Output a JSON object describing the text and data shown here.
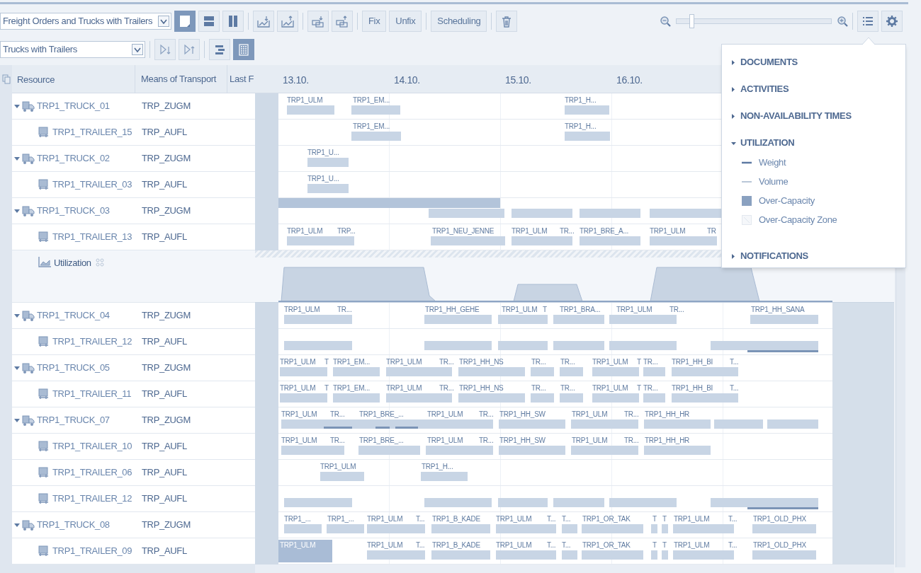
{
  "toolbar": {
    "view_select": {
      "value": "Freight Orders and Trucks with Trailers"
    },
    "layout_buttons": [
      {
        "selected": true
      },
      {
        "selected": false
      },
      {
        "selected": false
      }
    ],
    "text_buttons": [
      "Fix",
      "Unfix",
      "Scheduling"
    ],
    "zoom": {
      "level": 0.1
    },
    "hierarchy_select": {
      "value": "Trucks with Trailers"
    },
    "display_toggles": [
      {
        "selected": false
      },
      {
        "selected": true
      }
    ]
  },
  "table": {
    "columns": [
      "Resource",
      "Means of Transport",
      "Last F"
    ],
    "rows": [
      {
        "kind": "truck",
        "resource": "TRP1_TRUCK_01",
        "means": "TRP_ZUGM",
        "expanded": true,
        "orders": [
          {
            "label": "TRP1_ULM",
            "selected": false
          },
          {
            "label": "TRP1_EM...",
            "selected": false
          },
          {
            "label": "TRP1_H...",
            "selected": false
          }
        ]
      },
      {
        "kind": "trailer",
        "resource": "TRP1_TRAILER_15",
        "means": "TRP_AUFL",
        "orders": [
          {
            "label": "TRP1_EM...",
            "selected": false
          },
          {
            "label": "TRP1_H...",
            "selected": false
          }
        ]
      },
      {
        "kind": "truck",
        "resource": "TRP1_TRUCK_02",
        "means": "TRP_ZUGM",
        "expanded": true,
        "orders": [
          {
            "label": "TRP1_U...",
            "selected": false
          }
        ]
      },
      {
        "kind": "trailer",
        "resource": "TRP1_TRAILER_03",
        "means": "TRP_AUFL",
        "orders": [
          {
            "label": "TRP1_U...",
            "selected": false
          }
        ]
      },
      {
        "kind": "truck",
        "resource": "TRP1_TRUCK_03",
        "means": "TRP_ZUGM",
        "expanded": true
      },
      {
        "kind": "trailer",
        "resource": "TRP1_TRAILER_13",
        "means": "TRP_AUFL",
        "orders": [
          {
            "label": "TRP1_ULM",
            "selected": false
          },
          {
            "label": "TRP...",
            "selected": false
          },
          {
            "label": "TRP1_NEU_JENNE",
            "selected": false
          },
          {
            "label": "TRP1_ULM",
            "selected": false
          },
          {
            "label": "TR...",
            "selected": false
          },
          {
            "label": "TRP1_BRE_A...",
            "selected": false
          },
          {
            "label": "TRP1_ULM",
            "selected": false
          },
          {
            "label": "TR",
            "selected": false
          }
        ]
      },
      {
        "kind": "utilization",
        "resource": "Utilization"
      },
      {
        "kind": "truck",
        "resource": "TRP1_TRUCK_04",
        "means": "TRP_ZUGM",
        "expanded": true,
        "orders": [
          {
            "label": "TRP1_ULM",
            "selected": false
          },
          {
            "label": "TR...",
            "selected": false
          },
          {
            "label": "TRP1_HH_GEHE",
            "selected": false
          },
          {
            "label": "TRP1_ULM",
            "selected": false
          },
          {
            "label": "T",
            "selected": false
          },
          {
            "label": "TRP1_BRA...",
            "selected": false
          },
          {
            "label": "TRP1_ULM",
            "selected": false
          },
          {
            "label": "TR...",
            "selected": false
          },
          {
            "label": "TRP1_HH_SANA",
            "selected": false
          }
        ]
      },
      {
        "kind": "trailer",
        "resource": "TRP1_TRAILER_12",
        "means": "TRP_AUFL"
      },
      {
        "kind": "truck",
        "resource": "TRP1_TRUCK_05",
        "means": "TRP_ZUGM",
        "expanded": true,
        "orders": [
          {
            "label": "TRP1_ULM",
            "selected": false
          },
          {
            "label": "T",
            "selected": false
          },
          {
            "label": "TRP1_EM...",
            "selected": false
          },
          {
            "label": "TRP1_ULM",
            "selected": false
          },
          {
            "label": "TR...",
            "selected": false
          },
          {
            "label": "TRP1_HH_NS",
            "selected": false
          },
          {
            "label": "TR...",
            "selected": false
          },
          {
            "label": "TR...",
            "selected": false
          },
          {
            "label": "TRP1_ULM",
            "selected": false
          },
          {
            "label": "T",
            "selected": false
          },
          {
            "label": "TR...",
            "selected": false
          },
          {
            "label": "TRP1_HH_BI",
            "selected": false
          },
          {
            "label": "T...",
            "selected": false
          }
        ]
      },
      {
        "kind": "trailer",
        "resource": "TRP1_TRAILER_11",
        "means": "TRP_AUFL",
        "orders": [
          {
            "label": "TRP1_ULM",
            "selected": false
          },
          {
            "label": "T",
            "selected": false
          },
          {
            "label": "TRP1_EM...",
            "selected": false
          },
          {
            "label": "TRP1_ULM",
            "selected": false
          },
          {
            "label": "TR...",
            "selected": false
          },
          {
            "label": "TRP1_HH_NS",
            "selected": false
          },
          {
            "label": "TR...",
            "selected": false
          },
          {
            "label": "TR...",
            "selected": false
          },
          {
            "label": "TRP1_ULM",
            "selected": false
          },
          {
            "label": "T",
            "selected": false
          },
          {
            "label": "TR...",
            "selected": false
          },
          {
            "label": "TRP1_HH_BI",
            "selected": false
          },
          {
            "label": "T...",
            "selected": false
          }
        ]
      },
      {
        "kind": "truck",
        "resource": "TRP1_TRUCK_07",
        "means": "TRP_ZUGM",
        "expanded": true,
        "orders": [
          {
            "label": "TRP1_ULM",
            "selected": false
          },
          {
            "label": "TR...",
            "selected": false
          },
          {
            "label": "TRP1_BRE_...",
            "selected": false
          },
          {
            "label": "TRP1_ULM",
            "selected": false
          },
          {
            "label": "TR...",
            "selected": false
          },
          {
            "label": "TRP1_HH_SW",
            "selected": false
          },
          {
            "label": "TRP1_ULM",
            "selected": false
          },
          {
            "label": "TR...",
            "selected": false
          },
          {
            "label": "TRP1_HH_HR",
            "selected": false
          }
        ]
      },
      {
        "kind": "trailer",
        "resource": "TRP1_TRAILER_10",
        "means": "TRP_AUFL",
        "orders": [
          {
            "label": "TRP1_ULM",
            "selected": false
          },
          {
            "label": "TR...",
            "selected": false
          },
          {
            "label": "TRP1_BRE_...",
            "selected": false
          },
          {
            "label": "TRP1_ULM",
            "selected": false
          },
          {
            "label": "TR...",
            "selected": false
          },
          {
            "label": "TRP1_HH_SW",
            "selected": false
          },
          {
            "label": "TRP1_ULM",
            "selected": false
          },
          {
            "label": "TR...",
            "selected": false
          },
          {
            "label": "TRP1_HH_HR",
            "selected": false
          }
        ]
      },
      {
        "kind": "trailer",
        "resource": "TRP1_TRAILER_06",
        "means": "TRP_AUFL",
        "orders": [
          {
            "label": "TRP1_ULM",
            "selected": false
          },
          {
            "label": "TRP1_H...",
            "selected": false
          }
        ]
      },
      {
        "kind": "trailer",
        "resource": "TRP1_TRAILER_12",
        "means": "TRP_AUFL"
      },
      {
        "kind": "truck",
        "resource": "TRP1_TRUCK_08",
        "means": "TRP_ZUGM",
        "expanded": true,
        "orders": [
          {
            "label": "TRP1_...",
            "selected": false
          },
          {
            "label": "TRP1_...",
            "selected": false
          },
          {
            "label": "TRP1_ULM",
            "selected": false
          },
          {
            "label": "T...",
            "selected": false
          },
          {
            "label": "TRP1_B_KADE",
            "selected": false
          },
          {
            "label": "TRP1_ULM",
            "selected": false
          },
          {
            "label": "T...",
            "selected": false
          },
          {
            "label": "T...",
            "selected": false
          },
          {
            "label": "TRP1_OR_TAK",
            "selected": false
          },
          {
            "label": "T",
            "selected": false
          },
          {
            "label": "T",
            "selected": false
          },
          {
            "label": "TRP1_ULM",
            "selected": false
          },
          {
            "label": "T...",
            "selected": false
          },
          {
            "label": "TRP1_OLD_PHX",
            "selected": false
          }
        ]
      },
      {
        "kind": "trailer",
        "resource": "TRP1_TRAILER_09",
        "means": "TRP_AUFL",
        "orders": [
          {
            "label": "TRP1_ULM",
            "selected": true
          },
          {
            "label": "TRP1_ULM",
            "selected": false
          },
          {
            "label": "T...",
            "selected": false
          },
          {
            "label": "TRP1_B_KADE",
            "selected": false
          },
          {
            "label": "TRP1_ULM",
            "selected": false
          },
          {
            "label": "T...",
            "selected": false
          },
          {
            "label": "T...",
            "selected": false
          },
          {
            "label": "TRP1_OR_TAK",
            "selected": false
          },
          {
            "label": "T",
            "selected": false
          },
          {
            "label": "T",
            "selected": false
          },
          {
            "label": "TRP1_ULM",
            "selected": false
          },
          {
            "label": "T...",
            "selected": false
          },
          {
            "label": "TRP1_OLD_PHX",
            "selected": false
          }
        ]
      }
    ]
  },
  "timeline": {
    "dates": [
      "13.10.",
      "14.10.",
      "15.10.",
      "16.10."
    ]
  },
  "legend": {
    "sections": [
      {
        "title": "DOCUMENTS",
        "expanded": false
      },
      {
        "title": "ACTIVITIES",
        "expanded": false
      },
      {
        "title": "NON-AVAILABILITY TIMES",
        "expanded": false
      },
      {
        "title": "UTILIZATION",
        "expanded": true,
        "items": [
          {
            "kind": "weight",
            "label": "Weight"
          },
          {
            "kind": "volume",
            "label": "Volume"
          },
          {
            "kind": "over_capacity",
            "label": "Over-Capacity"
          },
          {
            "kind": "zone",
            "label": "Over-Capacity Zone"
          }
        ]
      },
      {
        "title": "NOTIFICATIONS",
        "expanded": false
      }
    ]
  }
}
